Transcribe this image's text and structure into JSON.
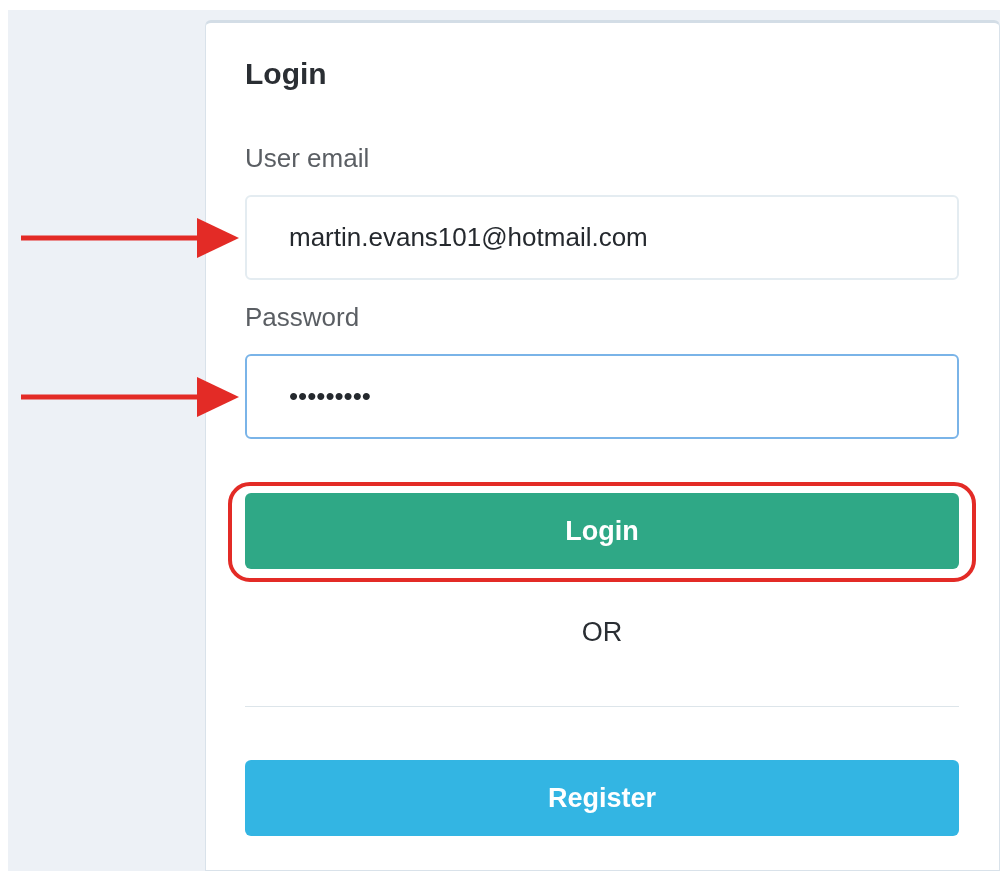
{
  "card": {
    "title": "Login"
  },
  "fields": [
    {
      "label": "User email",
      "value": "martin.evans101@hotmail.com",
      "focused": false,
      "annotated": true
    },
    {
      "label": "Password",
      "value": "•••••••••",
      "focused": true,
      "annotated": true
    }
  ],
  "login_button": {
    "label": "Login",
    "highlighted": true
  },
  "separator": "OR",
  "register_button": {
    "label": "Register"
  }
}
